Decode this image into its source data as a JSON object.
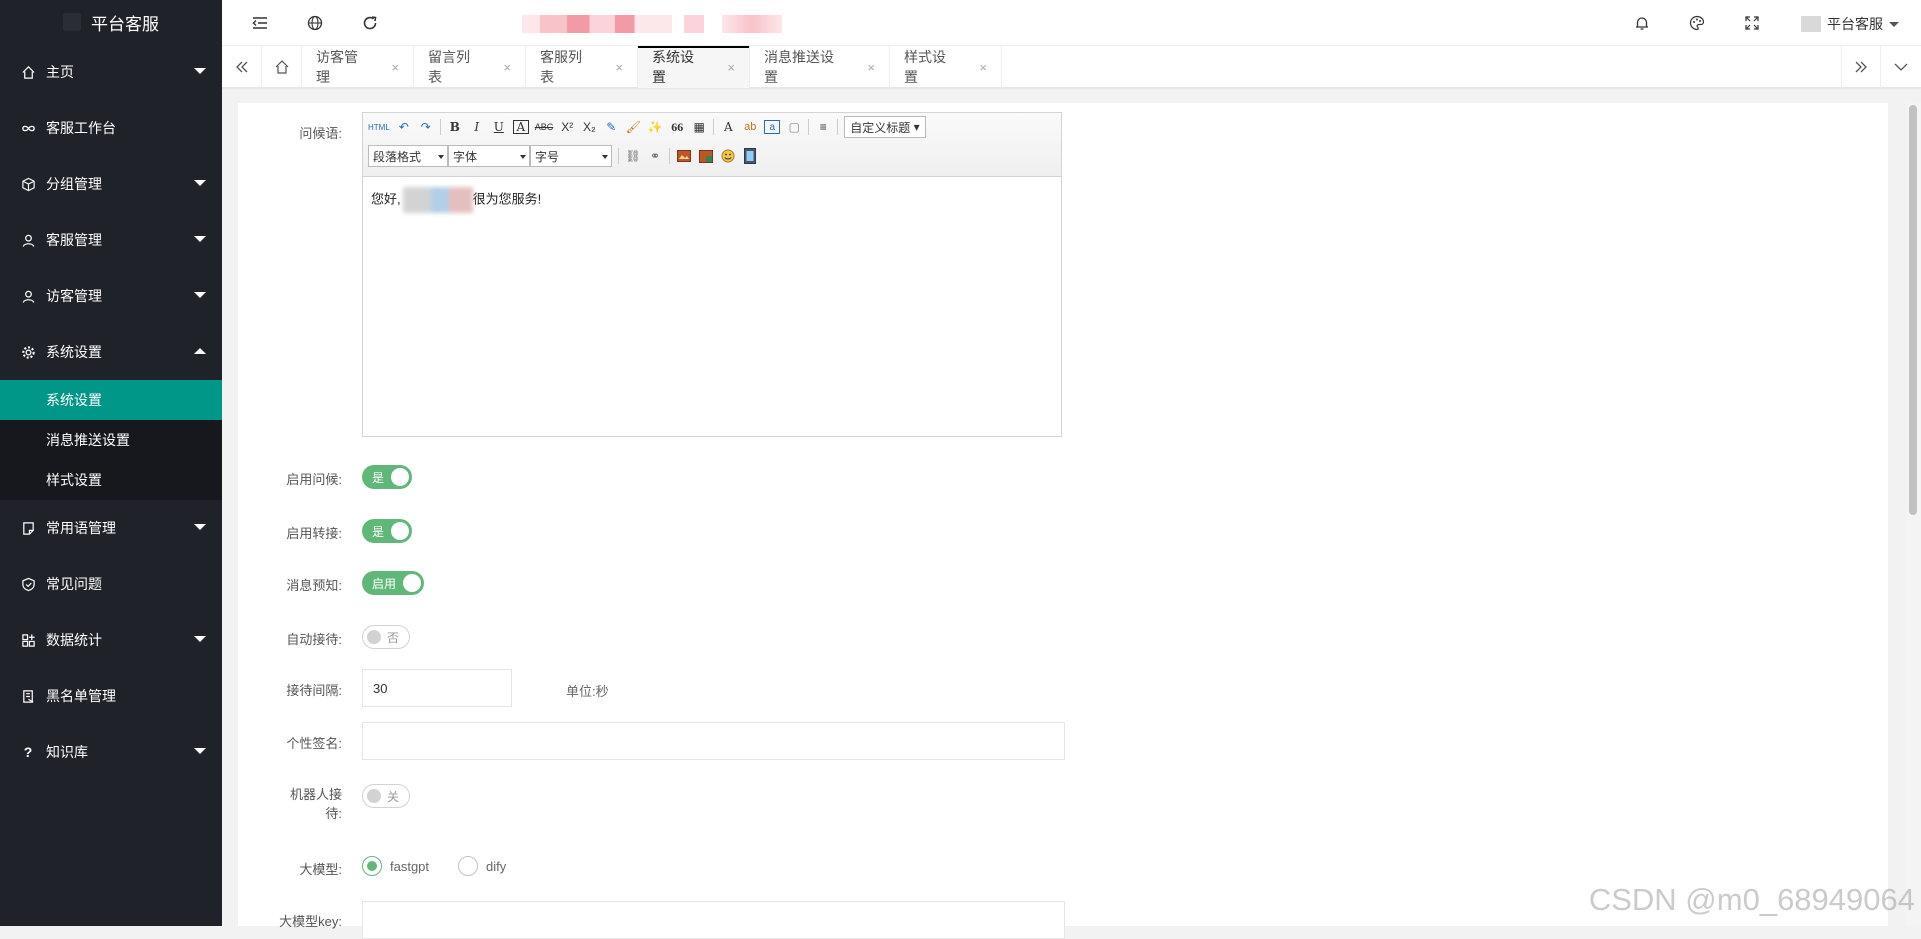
{
  "app": {
    "title": "平台客服"
  },
  "sidebar": {
    "items": [
      {
        "label": "主页",
        "icon": "home-icon",
        "arrow": "down"
      },
      {
        "label": "客服工作台",
        "icon": "infinity-icon",
        "arrow": ""
      },
      {
        "label": "分组管理",
        "icon": "cube-icon",
        "arrow": "down"
      },
      {
        "label": "客服管理",
        "icon": "user-icon",
        "arrow": "down"
      },
      {
        "label": "访客管理",
        "icon": "user-icon",
        "arrow": "down"
      },
      {
        "label": "系统设置",
        "icon": "gear-icon",
        "arrow": "up"
      },
      {
        "label": "常用语管理",
        "icon": "note-icon",
        "arrow": "down"
      },
      {
        "label": "常见问题",
        "icon": "shield-icon",
        "arrow": ""
      },
      {
        "label": "数据统计",
        "icon": "grid-icon",
        "arrow": "down"
      },
      {
        "label": "黑名单管理",
        "icon": "blacklist-icon",
        "arrow": ""
      },
      {
        "label": "知识库",
        "icon": "question-icon",
        "arrow": "down"
      }
    ],
    "submenu": [
      {
        "label": "系统设置",
        "active": true
      },
      {
        "label": "消息推送设置",
        "active": false
      },
      {
        "label": "样式设置",
        "active": false
      }
    ]
  },
  "header": {
    "icons": [
      "menu-fold-icon",
      "globe-icon",
      "refresh-icon",
      "bell-icon",
      "palette-icon",
      "fullscreen-icon"
    ],
    "user": "平台客服"
  },
  "tabs": {
    "items": [
      {
        "label": "访客管理",
        "active": false
      },
      {
        "label": "留言列表",
        "active": false
      },
      {
        "label": "客服列表",
        "active": false
      },
      {
        "label": "系统设置",
        "active": true
      },
      {
        "label": "消息推送设置",
        "active": false
      },
      {
        "label": "样式设置",
        "active": false
      }
    ],
    "close": "×"
  },
  "form": {
    "greeting_label": "问候语:",
    "editor": {
      "row1": [
        "HTML",
        "↶",
        "↷",
        "B",
        "I",
        "U",
        "A",
        "ABC",
        "X²",
        "X₂",
        "✎",
        "🖌",
        "✨",
        "66",
        "▦",
        "A",
        "ab",
        "a",
        "▢",
        "≡"
      ],
      "custom_title": "自定义标题",
      "paragraph": "段落格式",
      "font": "字体",
      "size": "字号",
      "content_before": "您好,",
      "content_after": "很为您服务!"
    },
    "enable_greeting": {
      "label": "启用问候:",
      "value": "是",
      "on": true
    },
    "enable_transfer": {
      "label": "启用转接:",
      "value": "是",
      "on": true
    },
    "message_preview": {
      "label": "消息预知:",
      "value": "启用",
      "on": true
    },
    "auto_reception": {
      "label": "自动接待:",
      "value": "否",
      "on": false
    },
    "reception_interval": {
      "label": "接待间隔:",
      "value": "30",
      "unit": "单位:秒"
    },
    "signature": {
      "label": "个性签名:",
      "value": ""
    },
    "robot_reception": {
      "label_line1": "机器人接",
      "label_line2": "待:",
      "value": "关",
      "on": false
    },
    "model": {
      "label": "大模型:",
      "options": [
        "fastgpt",
        "dify"
      ],
      "selected": "fastgpt"
    },
    "model_key": {
      "label": "大模型key:",
      "value": ""
    }
  },
  "watermark": "CSDN @m0_68949064",
  "colors": {
    "sidebar": "#20222a",
    "active": "#009688",
    "switch_on": "#5fb878"
  }
}
